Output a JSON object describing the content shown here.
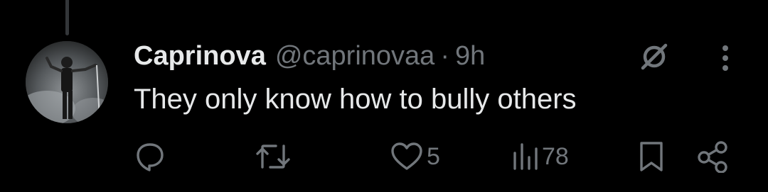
{
  "tweet": {
    "display_name": "Caprinova",
    "handle": "@caprinovaa",
    "separator": "·",
    "time": "9h",
    "text": "They only know how to bully others"
  },
  "actions": {
    "reply": {
      "icon": "reply-icon"
    },
    "retweet": {
      "icon": "retweet-icon"
    },
    "like": {
      "icon": "heart-icon",
      "count": "5"
    },
    "views": {
      "icon": "views-icon",
      "count": "78"
    },
    "bookmark": {
      "icon": "bookmark-icon"
    },
    "share": {
      "icon": "share-icon"
    }
  },
  "colors": {
    "background": "#000000",
    "primary_text": "#e7e9ea",
    "secondary_text": "#71767b"
  }
}
